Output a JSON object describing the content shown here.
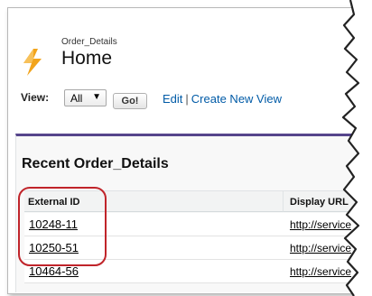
{
  "header": {
    "object_type": "Order_Details",
    "title": "Home",
    "icon": "lightning-bolt-icon"
  },
  "view_bar": {
    "label": "View:",
    "selected": "All",
    "go_label": "Go!",
    "edit_label": "Edit",
    "separator": "|",
    "create_label": "Create New View"
  },
  "recent": {
    "title": "Recent Order_Details",
    "columns": [
      "External ID",
      "Display URL"
    ],
    "rows": [
      {
        "external_id": "10248-11",
        "display_url": "http://service"
      },
      {
        "external_id": "10250-51",
        "display_url": "http://service"
      },
      {
        "external_id": "10464-56",
        "display_url": "http://service"
      }
    ]
  },
  "colors": {
    "accent": "#56458c",
    "link": "#015ba7",
    "highlight": "#c0242a",
    "icon": "#f2a41c"
  }
}
